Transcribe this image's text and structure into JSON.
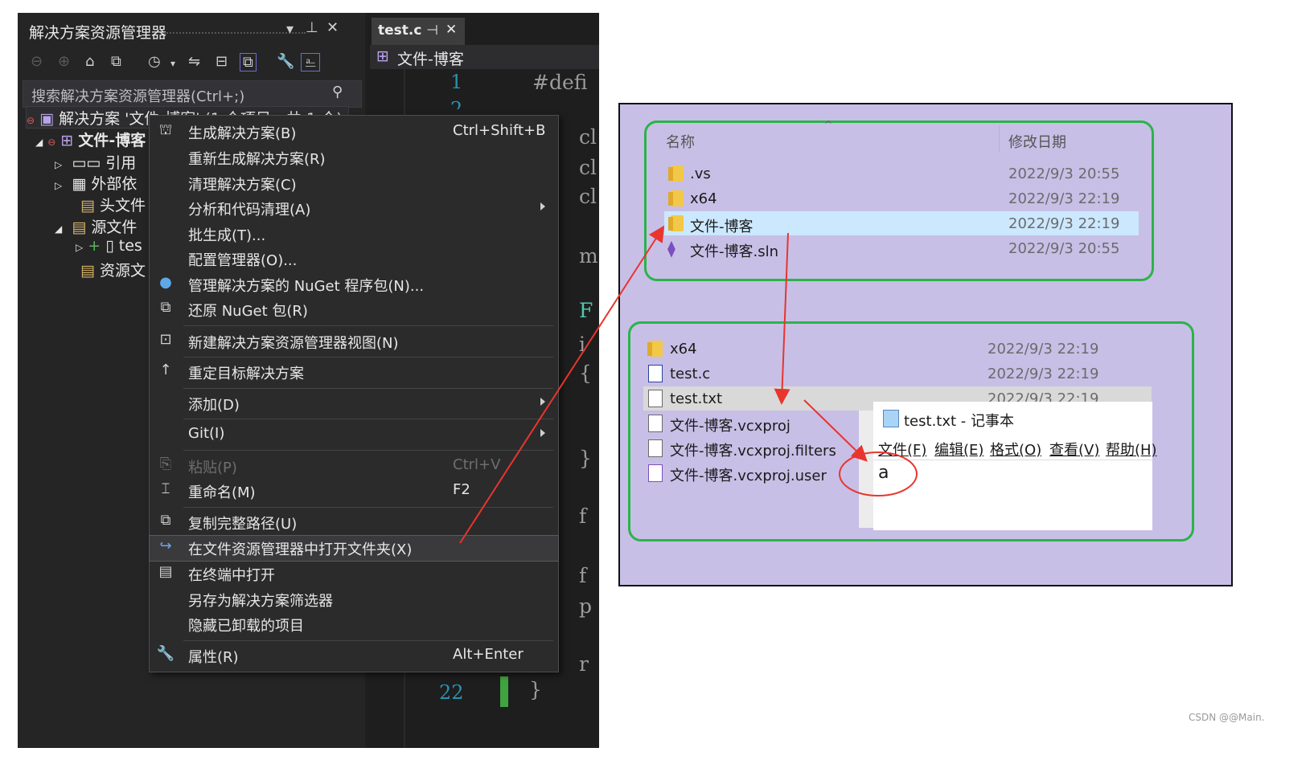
{
  "solution_explorer": {
    "title": "解决方案资源管理器",
    "search_placeholder": "搜索解决方案资源管理器(Ctrl+;)",
    "solution_node": "解决方案 '文件-博客' (1 个项目，共 1 个)",
    "project_node": "文件-博客",
    "tree_items": [
      "引用",
      "外部依",
      "头文件",
      "源文件",
      "tes",
      "资源文"
    ]
  },
  "editor": {
    "tab_label": "test.c",
    "file_header": "文件-博客",
    "line_numbers": [
      "1",
      "2",
      "22"
    ],
    "code_fragments": [
      "#defi",
      "}",
      "cl",
      "cl",
      "cl",
      "m",
      "F",
      "i",
      "{",
      "}",
      "f",
      "f",
      "p",
      "r"
    ]
  },
  "context_menu": {
    "items": [
      {
        "label": "生成解决方案(B)",
        "shortcut": "Ctrl+Shift+B"
      },
      {
        "label": "重新生成解决方案(R)"
      },
      {
        "label": "清理解决方案(C)"
      },
      {
        "label": "分析和代码清理(A)"
      },
      {
        "label": "批生成(T)..."
      },
      {
        "label": "配置管理器(O)..."
      },
      {
        "label": "管理解决方案的 NuGet 程序包(N)..."
      },
      {
        "label": "还原 NuGet 包(R)"
      },
      {
        "label": "新建解决方案资源管理器视图(N)"
      },
      {
        "label": "重定目标解决方案"
      },
      {
        "label": "添加(D)"
      },
      {
        "label": "Git(I)"
      },
      {
        "label": "粘贴(P)",
        "shortcut": "Ctrl+V"
      },
      {
        "label": "重命名(M)",
        "shortcut": "F2"
      },
      {
        "label": "复制完整路径(U)"
      },
      {
        "label": "在文件资源管理器中打开文件夹(X)"
      },
      {
        "label": "在终端中打开"
      },
      {
        "label": "另存为解决方案筛选器"
      },
      {
        "label": "隐藏已卸载的项目"
      },
      {
        "label": "属性(R)",
        "shortcut": "Alt+Enter"
      }
    ]
  },
  "explorer_top": {
    "col_name": "名称",
    "col_date": "修改日期",
    "rows": [
      {
        "name": ".vs",
        "date": "2022/9/3 20:55"
      },
      {
        "name": "x64",
        "date": "2022/9/3 22:19"
      },
      {
        "name": "文件-博客",
        "date": "2022/9/3 22:19"
      },
      {
        "name": "文件-博客.sln",
        "date": "2022/9/3 20:55"
      }
    ]
  },
  "explorer_bottom": {
    "rows": [
      {
        "name": "x64",
        "date": "2022/9/3 22:19"
      },
      {
        "name": "test.c",
        "date": "2022/9/3 22:19"
      },
      {
        "name": "test.txt",
        "date": "2022/9/3 22:19"
      },
      {
        "name": "文件-博客.vcxproj"
      },
      {
        "name": "文件-博客.vcxproj.filters"
      },
      {
        "name": "文件-博客.vcxproj.user"
      }
    ]
  },
  "notepad": {
    "title": "test.txt - 记事本",
    "menu": [
      "文件(F)",
      "编辑(E)",
      "格式(O)",
      "查看(V)",
      "帮助(H)"
    ],
    "content": "a"
  },
  "watermark": "CSDN @@Main.",
  "colors": {
    "annotation_red": "#e8352e",
    "box_green": "#2bb34a",
    "panel_bg": "#c8bfe6",
    "selection": "#cce8ff"
  }
}
